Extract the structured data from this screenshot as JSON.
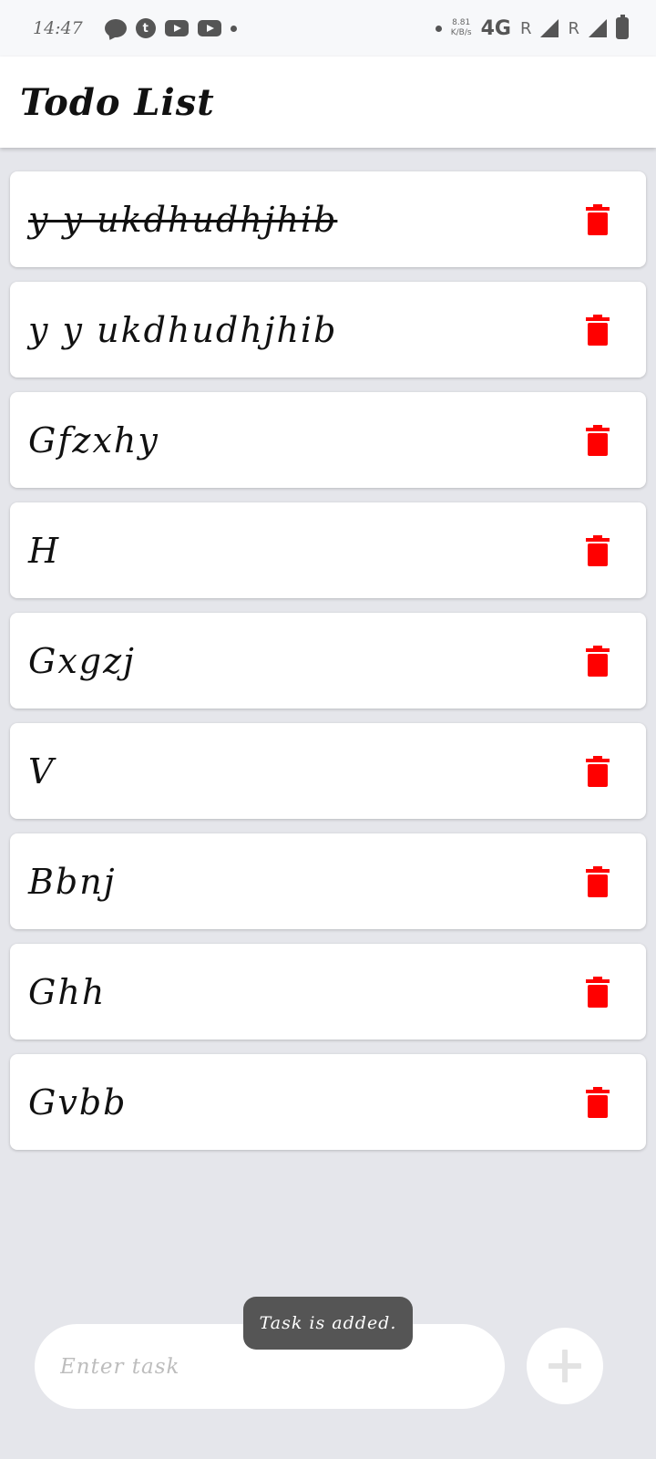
{
  "status_bar": {
    "time": "14:47",
    "speed_value": "8.81",
    "speed_unit": "K/B/s",
    "network": "4G",
    "roaming_1": "R",
    "roaming_2": "R"
  },
  "app_bar": {
    "title": "Todo List"
  },
  "tasks": [
    {
      "text": "y y ukdhudhjhib",
      "completed": true
    },
    {
      "text": "y y ukdhudhjhib",
      "completed": false
    },
    {
      "text": "Gfzxhy",
      "completed": false
    },
    {
      "text": "H",
      "completed": false
    },
    {
      "text": "Gxgzj",
      "completed": false
    },
    {
      "text": "V",
      "completed": false
    },
    {
      "text": "Bbnj",
      "completed": false
    },
    {
      "text": "Ghh",
      "completed": false
    },
    {
      "text": "Gvbb",
      "completed": false
    }
  ],
  "toast": {
    "message": "Task is added."
  },
  "input": {
    "placeholder": "Enter task",
    "value": ""
  },
  "colors": {
    "delete_icon": "#ff0000",
    "add_icon": "#e3e3e3",
    "background": "#e5e6eb"
  },
  "icons": {
    "delete": "trash-icon",
    "add": "plus-icon"
  }
}
